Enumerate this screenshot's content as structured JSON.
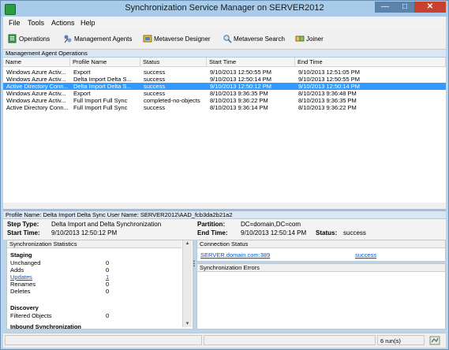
{
  "window": {
    "title": "Synchronization Service Manager on SERVER2012",
    "minimize": "—",
    "maximize": "□",
    "close": "✕"
  },
  "menu": {
    "file": "File",
    "tools": "Tools",
    "actions": "Actions",
    "help": "Help"
  },
  "toolbar": {
    "operations": "Operations",
    "management_agents": "Management Agents",
    "metaverse_designer": "Metaverse Designer",
    "metaverse_search": "Metaverse Search",
    "joiner": "Joiner"
  },
  "operations_header": "Management Agent Operations",
  "grid": {
    "columns": [
      "Name",
      "Profile Name",
      "Status",
      "Start Time",
      "End Time"
    ],
    "rows": [
      [
        "Windows Azure Activ...",
        "Export",
        "success",
        "9/10/2013 12:50:55 PM",
        "9/10/2013 12:51:05 PM"
      ],
      [
        "Windows Azure Activ...",
        "Delta Import Delta S...",
        "success",
        "9/10/2013 12:50:14 PM",
        "9/10/2013 12:50:55 PM"
      ],
      [
        "Active Directory Conn...",
        "Delta Import Delta S...",
        "success",
        "9/10/2013 12:50:12 PM",
        "9/10/2013 12:50:14 PM"
      ],
      [
        "Windows Azure Activ...",
        "Export",
        "success",
        "8/10/2013 9:36:35 PM",
        "8/10/2013 9:36:48 PM"
      ],
      [
        "Windows Azure Activ...",
        "Full Import Full Sync",
        "completed-no-objects",
        "8/10/2013 9:36:22 PM",
        "8/10/2013 9:36:35 PM"
      ],
      [
        "Active Directory Conn...",
        "Full Import Full Sync",
        "success",
        "8/10/2013 9:36:14 PM",
        "8/10/2013 9:36:22 PM"
      ]
    ],
    "selected_index": 2
  },
  "profile": {
    "bar_text": "Profile Name: Delta Import Delta Sync  User Name: SERVER2012\\AAD_fcb3da2b21a2",
    "step_type_label": "Step Type:",
    "step_type_value": "Delta Import and Delta Synchronization",
    "start_time_label": "Start Time:",
    "start_time_value": "9/10/2013 12:50:12 PM",
    "partition_label": "Partition:",
    "partition_value": "DC=domain,DC=com",
    "end_time_label": "End Time:",
    "end_time_value": "9/10/2013 12:50:14 PM",
    "status_label": "Status:",
    "status_value": "success"
  },
  "sync_stats": {
    "title": "Synchronization Statistics",
    "staging_header": "Staging",
    "unchanged_label": "Unchanged",
    "unchanged_value": "0",
    "adds_label": "Adds",
    "adds_value": "0",
    "updates_label": "Updates",
    "updates_value": "1",
    "renames_label": "Renames",
    "renames_value": "0",
    "deletes_label": "Deletes",
    "deletes_value": "0",
    "discovery_header": "Discovery",
    "filtered_label": "Filtered Objects",
    "filtered_value": "0",
    "inbound_header": "Inbound Synchronization"
  },
  "connection_status": {
    "title": "Connection Status",
    "server": "SERVER.domain.com:389",
    "result": "success"
  },
  "sync_errors": {
    "title": "Synchronization Errors"
  },
  "statusbar": {
    "runs": "6 run(s)"
  }
}
